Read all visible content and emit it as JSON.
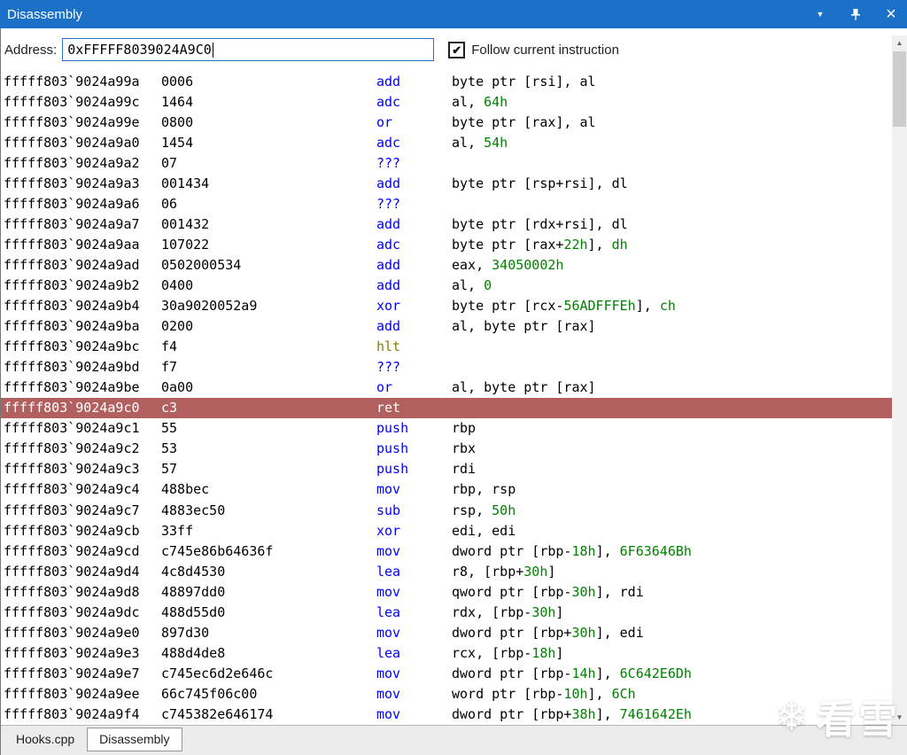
{
  "titlebar": {
    "title": "Disassembly",
    "dropdown_glyph": "▼",
    "close_glyph": "×"
  },
  "toolbar": {
    "address_label": "Address:",
    "address_value": "0xFFFFF8039024A9C0",
    "follow_label": "Follow current instruction",
    "follow_checked": true,
    "check_glyph": "✔"
  },
  "colors": {
    "titlebar_bg": "#1b70c8",
    "highlight_row_bg": "#b25f5f",
    "mnemonic": "#0000ff",
    "number": "#008000",
    "hlt_mnemonic": "#808000",
    "input_focus_border": "#2a72c8"
  },
  "scrollbar": {
    "up_glyph": "▲",
    "down_glyph": "▼"
  },
  "listing": {
    "rows": [
      {
        "addr": "fffff803`9024a99a",
        "bytes": "0006",
        "mn": "add",
        "ops": [
          [
            "byte ptr [rsi], al",
            "k"
          ]
        ]
      },
      {
        "addr": "fffff803`9024a99c",
        "bytes": "1464",
        "mn": "adc",
        "ops": [
          [
            "al, ",
            "k"
          ],
          [
            "64h",
            "g"
          ]
        ]
      },
      {
        "addr": "fffff803`9024a99e",
        "bytes": "0800",
        "mn": "or",
        "ops": [
          [
            "byte ptr [rax], al",
            "k"
          ]
        ]
      },
      {
        "addr": "fffff803`9024a9a0",
        "bytes": "1454",
        "mn": "adc",
        "ops": [
          [
            "al, ",
            "k"
          ],
          [
            "54h",
            "g"
          ]
        ]
      },
      {
        "addr": "fffff803`9024a9a2",
        "bytes": "07",
        "mn": "???",
        "ops": []
      },
      {
        "addr": "fffff803`9024a9a3",
        "bytes": "001434",
        "mn": "add",
        "ops": [
          [
            "byte ptr [rsp+rsi], dl",
            "k"
          ]
        ]
      },
      {
        "addr": "fffff803`9024a9a6",
        "bytes": "06",
        "mn": "???",
        "ops": []
      },
      {
        "addr": "fffff803`9024a9a7",
        "bytes": "001432",
        "mn": "add",
        "ops": [
          [
            "byte ptr [rdx+rsi], dl",
            "k"
          ]
        ]
      },
      {
        "addr": "fffff803`9024a9aa",
        "bytes": "107022",
        "mn": "adc",
        "ops": [
          [
            "byte ptr [rax+",
            "k"
          ],
          [
            "22h",
            "g"
          ],
          [
            "], ",
            "k"
          ],
          [
            "dh",
            "g"
          ]
        ]
      },
      {
        "addr": "fffff803`9024a9ad",
        "bytes": "0502000534",
        "mn": "add",
        "ops": [
          [
            "eax, ",
            "k"
          ],
          [
            "34050002h",
            "g"
          ]
        ]
      },
      {
        "addr": "fffff803`9024a9b2",
        "bytes": "0400",
        "mn": "add",
        "ops": [
          [
            "al, ",
            "k"
          ],
          [
            "0",
            "g"
          ]
        ]
      },
      {
        "addr": "fffff803`9024a9b4",
        "bytes": "30a9020052a9",
        "mn": "xor",
        "ops": [
          [
            "byte ptr [rcx-",
            "k"
          ],
          [
            "56ADFFFEh",
            "g"
          ],
          [
            "], ",
            "k"
          ],
          [
            "ch",
            "g"
          ]
        ]
      },
      {
        "addr": "fffff803`9024a9ba",
        "bytes": "0200",
        "mn": "add",
        "ops": [
          [
            "al, byte ptr [rax]",
            "k"
          ]
        ]
      },
      {
        "addr": "fffff803`9024a9bc",
        "bytes": "f4",
        "mn": "hlt",
        "mc": "o",
        "ops": []
      },
      {
        "addr": "fffff803`9024a9bd",
        "bytes": "f7",
        "mn": "???",
        "ops": []
      },
      {
        "addr": "fffff803`9024a9be",
        "bytes": "0a00",
        "mn": "or",
        "ops": [
          [
            "al, byte ptr [rax]",
            "k"
          ]
        ]
      },
      {
        "addr": "fffff803`9024a9c0",
        "bytes": "c3",
        "mn": "ret",
        "hl": true,
        "ops": []
      },
      {
        "addr": "fffff803`9024a9c1",
        "bytes": "55",
        "mn": "push",
        "ops": [
          [
            "rbp",
            "k"
          ]
        ]
      },
      {
        "addr": "fffff803`9024a9c2",
        "bytes": "53",
        "mn": "push",
        "ops": [
          [
            "rbx",
            "k"
          ]
        ]
      },
      {
        "addr": "fffff803`9024a9c3",
        "bytes": "57",
        "mn": "push",
        "ops": [
          [
            "rdi",
            "k"
          ]
        ]
      },
      {
        "addr": "fffff803`9024a9c4",
        "bytes": "488bec",
        "mn": "mov",
        "ops": [
          [
            "rbp, rsp",
            "k"
          ]
        ]
      },
      {
        "addr": "fffff803`9024a9c7",
        "bytes": "4883ec50",
        "mn": "sub",
        "ops": [
          [
            "rsp, ",
            "k"
          ],
          [
            "50h",
            "g"
          ]
        ]
      },
      {
        "addr": "fffff803`9024a9cb",
        "bytes": "33ff",
        "mn": "xor",
        "ops": [
          [
            "edi, edi",
            "k"
          ]
        ]
      },
      {
        "addr": "fffff803`9024a9cd",
        "bytes": "c745e86b64636f",
        "mn": "mov",
        "ops": [
          [
            "dword ptr [rbp-",
            "k"
          ],
          [
            "18h",
            "g"
          ],
          [
            "], ",
            "k"
          ],
          [
            "6F63646Bh",
            "g"
          ]
        ]
      },
      {
        "addr": "fffff803`9024a9d4",
        "bytes": "4c8d4530",
        "mn": "lea",
        "ops": [
          [
            "r8, [rbp+",
            "k"
          ],
          [
            "30h",
            "g"
          ],
          [
            "]",
            "k"
          ]
        ]
      },
      {
        "addr": "fffff803`9024a9d8",
        "bytes": "48897dd0",
        "mn": "mov",
        "ops": [
          [
            "qword ptr [rbp-",
            "k"
          ],
          [
            "30h",
            "g"
          ],
          [
            "], rdi",
            "k"
          ]
        ]
      },
      {
        "addr": "fffff803`9024a9dc",
        "bytes": "488d55d0",
        "mn": "lea",
        "ops": [
          [
            "rdx, [rbp-",
            "k"
          ],
          [
            "30h",
            "g"
          ],
          [
            "]",
            "k"
          ]
        ]
      },
      {
        "addr": "fffff803`9024a9e0",
        "bytes": "897d30",
        "mn": "mov",
        "ops": [
          [
            "dword ptr [rbp+",
            "k"
          ],
          [
            "30h",
            "g"
          ],
          [
            "], edi",
            "k"
          ]
        ]
      },
      {
        "addr": "fffff803`9024a9e3",
        "bytes": "488d4de8",
        "mn": "lea",
        "ops": [
          [
            "rcx, [rbp-",
            "k"
          ],
          [
            "18h",
            "g"
          ],
          [
            "]",
            "k"
          ]
        ]
      },
      {
        "addr": "fffff803`9024a9e7",
        "bytes": "c745ec6d2e646c",
        "mn": "mov",
        "ops": [
          [
            "dword ptr [rbp-",
            "k"
          ],
          [
            "14h",
            "g"
          ],
          [
            "], ",
            "k"
          ],
          [
            "6C642E6Dh",
            "g"
          ]
        ]
      },
      {
        "addr": "fffff803`9024a9ee",
        "bytes": "66c745f06c00",
        "mn": "mov",
        "ops": [
          [
            "word ptr [rbp-",
            "k"
          ],
          [
            "10h",
            "g"
          ],
          [
            "], ",
            "k"
          ],
          [
            "6Ch",
            "g"
          ]
        ]
      },
      {
        "addr": "fffff803`9024a9f4",
        "bytes": "c745382e646174",
        "mn": "mov",
        "ops": [
          [
            "dword ptr [rbp+",
            "k"
          ],
          [
            "38h",
            "g"
          ],
          [
            "], ",
            "k"
          ],
          [
            "7461642Eh",
            "g"
          ]
        ]
      }
    ]
  },
  "tabs": [
    {
      "label": "Hooks.cpp",
      "active": false
    },
    {
      "label": "Disassembly",
      "active": true
    }
  ],
  "watermark": {
    "text": "看雪",
    "icon": "snowflake"
  }
}
